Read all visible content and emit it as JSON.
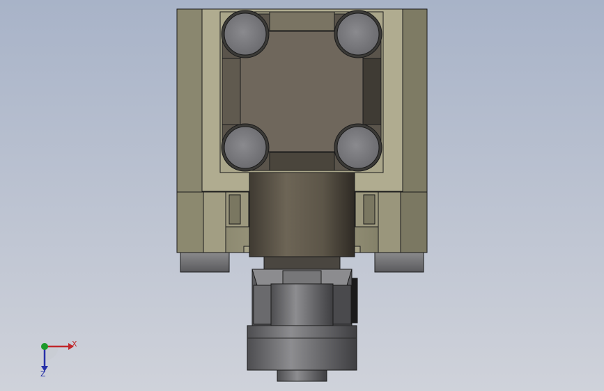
{
  "viewport": {
    "background_top": "#a8b3c8",
    "background_bottom": "#cfd2da"
  },
  "model": {
    "body_color": "#8f8c73",
    "body_shade_color": "#6e6b55",
    "plate_color": "#a9a58a",
    "pocket_color": "#6e665c",
    "cylinder_color": "#5f594c",
    "bolt_color": "#7c7c80",
    "edge_color": "#1b1b1b"
  },
  "triad": {
    "x_label": "X",
    "z_label": "Z",
    "x_color": "#c0282c",
    "z_color": "#2630a8",
    "y_color": "#1c9a2a"
  }
}
